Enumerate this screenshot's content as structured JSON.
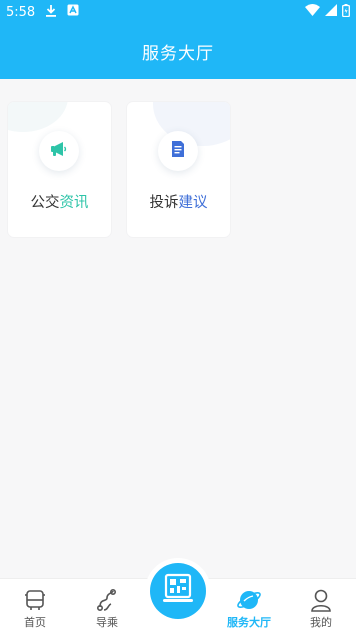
{
  "status": {
    "time": "5:58"
  },
  "header": {
    "title": "服务大厅"
  },
  "cards": [
    {
      "label_plain": "公交",
      "label_accent": "资讯",
      "accent_color": "#2ec4a8"
    },
    {
      "label_plain": "投诉",
      "label_accent": "建议",
      "accent_color": "#3f6fd8"
    }
  ],
  "nav": {
    "items": [
      {
        "label": "首页"
      },
      {
        "label": "导乘"
      },
      {
        "label": "服务大厅"
      },
      {
        "label": "我的"
      }
    ]
  },
  "colors": {
    "primary": "#1fb7f7",
    "background": "#f7f7f8"
  }
}
